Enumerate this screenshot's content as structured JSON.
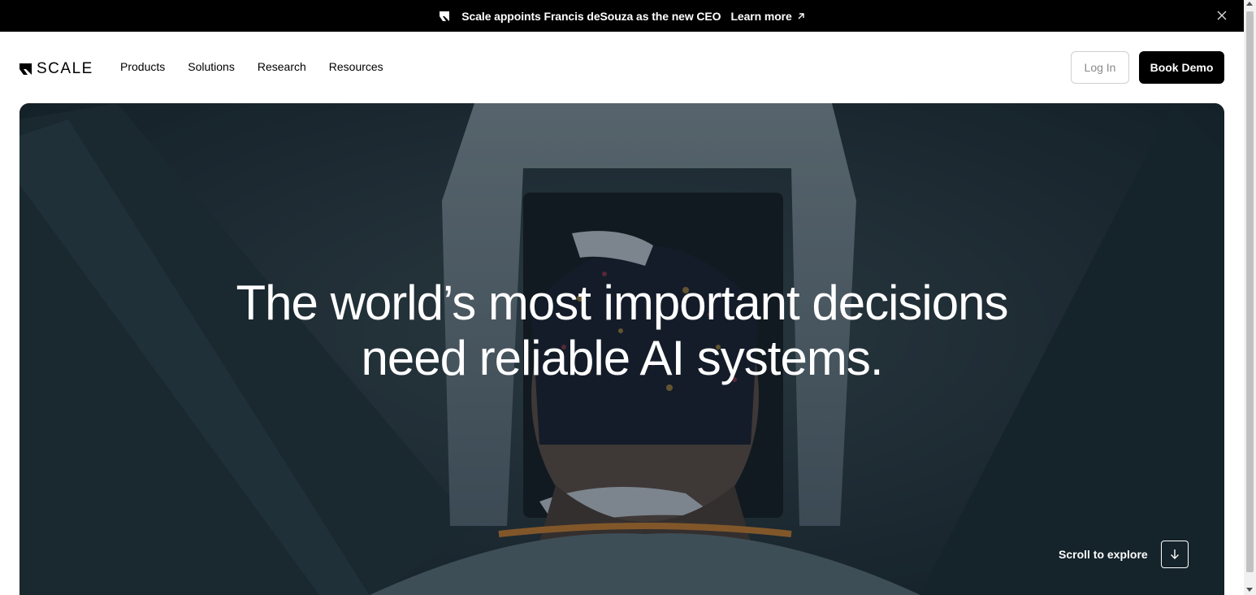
{
  "announcement": {
    "text": "Scale appoints Francis deSouza as the new CEO",
    "link": "Learn more"
  },
  "nav": {
    "logo_text": "SCALE",
    "links": [
      "Products",
      "Solutions",
      "Research",
      "Resources"
    ],
    "login_label": "Log In",
    "demo_label": "Book Demo"
  },
  "hero": {
    "title_line1": "The world’s most important decisions",
    "title_line2": "need reliable AI systems.",
    "scroll_label": "Scroll to explore"
  },
  "colors": {
    "black": "#000000",
    "hero_overlay": "#1e2c34",
    "white": "#ffffff"
  }
}
